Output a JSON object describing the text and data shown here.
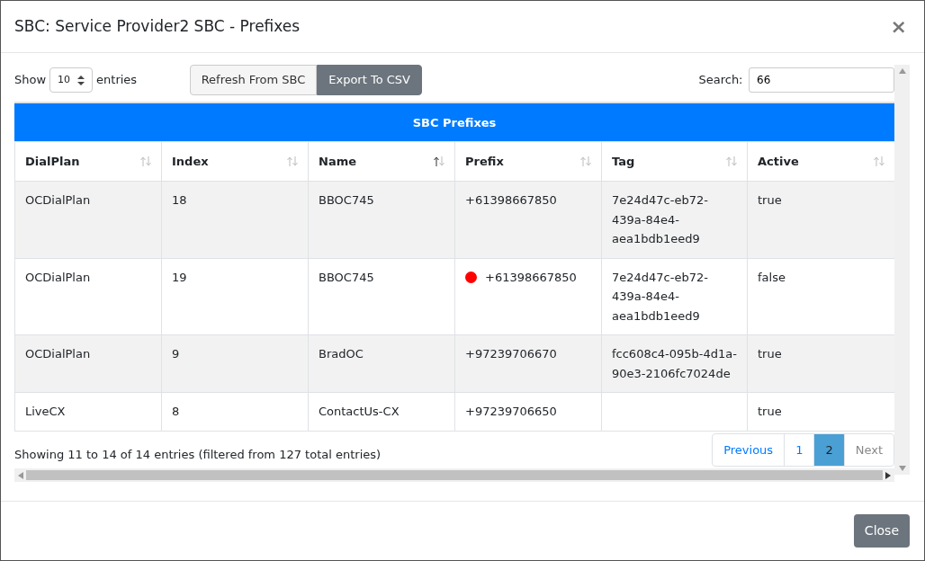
{
  "modal": {
    "title": "SBC: Service Provider2 SBC - Prefixes",
    "close_symbol": "×"
  },
  "length_control": {
    "before": "Show",
    "value": "10",
    "after": "entries"
  },
  "buttons": [
    {
      "label": "Refresh From SBC",
      "kind": "light"
    },
    {
      "label": "Export To CSV",
      "kind": "secondary"
    }
  ],
  "search": {
    "label": "Search:",
    "value": "66"
  },
  "table": {
    "caption": "SBC Prefixes",
    "columns": [
      {
        "label": "DialPlan",
        "sorted": false
      },
      {
        "label": "Index",
        "sorted": false
      },
      {
        "label": "Name",
        "sorted": true
      },
      {
        "label": "Prefix",
        "sorted": false
      },
      {
        "label": "Tag",
        "sorted": false
      },
      {
        "label": "Active",
        "sorted": false
      }
    ],
    "rows": [
      {
        "cells": [
          "OCDialPlan",
          "18",
          "BBOC745",
          "+61398667850",
          "7e24d47c-eb72-439a-84e4-aea1bdb1eed9",
          "true"
        ],
        "flag": false
      },
      {
        "cells": [
          "OCDialPlan",
          "19",
          "BBOC745",
          "+61398667850",
          "7e24d47c-eb72-439a-84e4-aea1bdb1eed9",
          "false"
        ],
        "flag": true,
        "color": "#ff0000"
      },
      {
        "cells": [
          "OCDialPlan",
          "9",
          "BradOC",
          "+97239706670",
          "fcc608c4-095b-4d1a-90e3-2106fc7024de",
          "true"
        ],
        "flag": false
      },
      {
        "cells": [
          "LiveCX",
          "8",
          "ContactUs-CX",
          "+97239706650",
          "",
          "true"
        ],
        "flag": false
      }
    ]
  },
  "info": "Showing 11 to 14 of 14 entries (filtered from 127 total entries)",
  "pagination": [
    {
      "label": "Previous",
      "disabled": false,
      "selected": false
    },
    {
      "label": "1",
      "disabled": false,
      "selected": false
    },
    {
      "label": "2",
      "disabled": false,
      "selected": true
    },
    {
      "label": "Next",
      "disabled": true,
      "selected": false
    }
  ],
  "footer": {
    "close_label": "Close"
  }
}
